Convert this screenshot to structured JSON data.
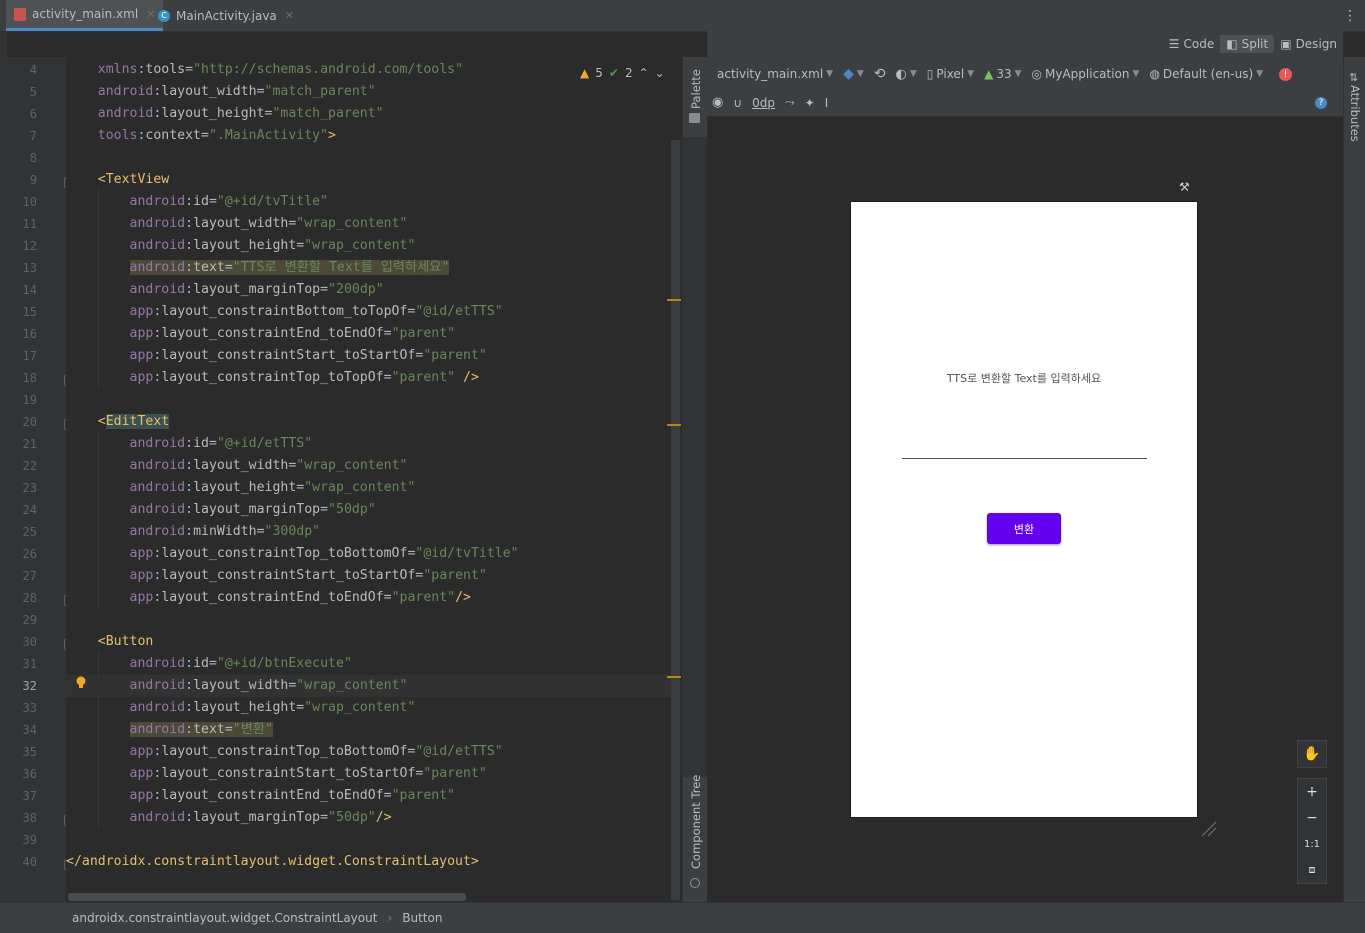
{
  "tabs": [
    {
      "label": "activity_main.xml",
      "active": true
    },
    {
      "label": "MainActivity.java",
      "active": false
    }
  ],
  "editor": {
    "warnings": "5",
    "weak_warnings": "2",
    "line_numbers": [
      "4",
      "5",
      "6",
      "7",
      "8",
      "9",
      "10",
      "11",
      "12",
      "13",
      "14",
      "15",
      "16",
      "17",
      "18",
      "19",
      "20",
      "21",
      "22",
      "23",
      "24",
      "25",
      "26",
      "27",
      "28",
      "29",
      "30",
      "31",
      "32",
      "33",
      "34",
      "35",
      "36",
      "37",
      "38",
      "39",
      "40"
    ],
    "current_line": "32",
    "lines": [
      {
        "indent": "    ",
        "parts": [
          [
            "an",
            "xmlns"
          ],
          [
            "pu",
            ":"
          ],
          [
            "at",
            "tools"
          ],
          [
            "pu",
            "="
          ],
          [
            "av",
            "\"http://schemas.android.com/tools\""
          ]
        ]
      },
      {
        "indent": "    ",
        "parts": [
          [
            "an",
            "android"
          ],
          [
            "pu",
            ":"
          ],
          [
            "at",
            "layout_width"
          ],
          [
            "pu",
            "="
          ],
          [
            "av",
            "\"match_parent\""
          ]
        ]
      },
      {
        "indent": "    ",
        "parts": [
          [
            "an",
            "android"
          ],
          [
            "pu",
            ":"
          ],
          [
            "at",
            "layout_height"
          ],
          [
            "pu",
            "="
          ],
          [
            "av",
            "\"match_parent\""
          ]
        ]
      },
      {
        "indent": "    ",
        "parts": [
          [
            "an",
            "tools"
          ],
          [
            "pu",
            ":"
          ],
          [
            "at",
            "context"
          ],
          [
            "pu",
            "="
          ],
          [
            "av",
            "\".MainActivity\""
          ],
          [
            "tg",
            ">"
          ]
        ]
      },
      {
        "indent": "",
        "parts": []
      },
      {
        "indent": "    ",
        "parts": [
          [
            "tg",
            "<TextView"
          ]
        ]
      },
      {
        "indent": "        ",
        "parts": [
          [
            "an",
            "android"
          ],
          [
            "pu",
            ":"
          ],
          [
            "at",
            "id"
          ],
          [
            "pu",
            "="
          ],
          [
            "av",
            "\"@+id/tvTitle\""
          ]
        ]
      },
      {
        "indent": "        ",
        "parts": [
          [
            "an",
            "android"
          ],
          [
            "pu",
            ":"
          ],
          [
            "at",
            "layout_width"
          ],
          [
            "pu",
            "="
          ],
          [
            "av",
            "\"wrap_content\""
          ]
        ]
      },
      {
        "indent": "        ",
        "parts": [
          [
            "an",
            "android"
          ],
          [
            "pu",
            ":"
          ],
          [
            "at",
            "layout_height"
          ],
          [
            "pu",
            "="
          ],
          [
            "av",
            "\"wrap_content\""
          ]
        ]
      },
      {
        "indent": "        ",
        "hl": true,
        "parts": [
          [
            "an",
            "android"
          ],
          [
            "pu",
            ":"
          ],
          [
            "at",
            "text"
          ],
          [
            "pu",
            "="
          ],
          [
            "av",
            "\"TTS로 변환할 Text를 입력하세요\""
          ]
        ]
      },
      {
        "indent": "        ",
        "parts": [
          [
            "an",
            "android"
          ],
          [
            "pu",
            ":"
          ],
          [
            "at",
            "layout_marginTop"
          ],
          [
            "pu",
            "="
          ],
          [
            "av",
            "\"200dp\""
          ]
        ]
      },
      {
        "indent": "        ",
        "parts": [
          [
            "an",
            "app"
          ],
          [
            "pu",
            ":"
          ],
          [
            "at",
            "layout_constraintBottom_toTopOf"
          ],
          [
            "pu",
            "="
          ],
          [
            "av",
            "\"@id/etTTS\""
          ]
        ]
      },
      {
        "indent": "        ",
        "parts": [
          [
            "an",
            "app"
          ],
          [
            "pu",
            ":"
          ],
          [
            "at",
            "layout_constraintEnd_toEndOf"
          ],
          [
            "pu",
            "="
          ],
          [
            "av",
            "\"parent\""
          ]
        ]
      },
      {
        "indent": "        ",
        "parts": [
          [
            "an",
            "app"
          ],
          [
            "pu",
            ":"
          ],
          [
            "at",
            "layout_constraintStart_toStartOf"
          ],
          [
            "pu",
            "="
          ],
          [
            "av",
            "\"parent\""
          ]
        ]
      },
      {
        "indent": "        ",
        "parts": [
          [
            "an",
            "app"
          ],
          [
            "pu",
            ":"
          ],
          [
            "at",
            "layout_constraintTop_toTopOf"
          ],
          [
            "pu",
            "="
          ],
          [
            "av",
            "\"parent\""
          ],
          [
            "tg",
            " />"
          ]
        ]
      },
      {
        "indent": "",
        "parts": []
      },
      {
        "indent": "    ",
        "parts": [
          [
            "tg",
            "<"
          ],
          [
            "hltag",
            "EditText"
          ]
        ]
      },
      {
        "indent": "        ",
        "parts": [
          [
            "an",
            "android"
          ],
          [
            "pu",
            ":"
          ],
          [
            "at",
            "id"
          ],
          [
            "pu",
            "="
          ],
          [
            "av",
            "\"@+id/etTTS\""
          ]
        ]
      },
      {
        "indent": "        ",
        "parts": [
          [
            "an",
            "android"
          ],
          [
            "pu",
            ":"
          ],
          [
            "at",
            "layout_width"
          ],
          [
            "pu",
            "="
          ],
          [
            "av",
            "\"wrap_content\""
          ]
        ]
      },
      {
        "indent": "        ",
        "parts": [
          [
            "an",
            "android"
          ],
          [
            "pu",
            ":"
          ],
          [
            "at",
            "layout_height"
          ],
          [
            "pu",
            "="
          ],
          [
            "av",
            "\"wrap_content\""
          ]
        ]
      },
      {
        "indent": "        ",
        "parts": [
          [
            "an",
            "android"
          ],
          [
            "pu",
            ":"
          ],
          [
            "at",
            "layout_marginTop"
          ],
          [
            "pu",
            "="
          ],
          [
            "av",
            "\"50dp\""
          ]
        ]
      },
      {
        "indent": "        ",
        "parts": [
          [
            "an",
            "android"
          ],
          [
            "pu",
            ":"
          ],
          [
            "at",
            "minWidth"
          ],
          [
            "pu",
            "="
          ],
          [
            "av",
            "\"300dp\""
          ]
        ]
      },
      {
        "indent": "        ",
        "parts": [
          [
            "an",
            "app"
          ],
          [
            "pu",
            ":"
          ],
          [
            "at",
            "layout_constraintTop_toBottomOf"
          ],
          [
            "pu",
            "="
          ],
          [
            "av",
            "\"@id/tvTitle\""
          ]
        ]
      },
      {
        "indent": "        ",
        "parts": [
          [
            "an",
            "app"
          ],
          [
            "pu",
            ":"
          ],
          [
            "at",
            "layout_constraintStart_toStartOf"
          ],
          [
            "pu",
            "="
          ],
          [
            "av",
            "\"parent\""
          ]
        ]
      },
      {
        "indent": "        ",
        "parts": [
          [
            "an",
            "app"
          ],
          [
            "pu",
            ":"
          ],
          [
            "at",
            "layout_constraintEnd_toEndOf"
          ],
          [
            "pu",
            "="
          ],
          [
            "av",
            "\"parent\""
          ],
          [
            "tg",
            "/>"
          ]
        ]
      },
      {
        "indent": "",
        "parts": []
      },
      {
        "indent": "    ",
        "parts": [
          [
            "tg",
            "<Button"
          ]
        ]
      },
      {
        "indent": "        ",
        "parts": [
          [
            "an",
            "android"
          ],
          [
            "pu",
            ":"
          ],
          [
            "at",
            "id"
          ],
          [
            "pu",
            "="
          ],
          [
            "av",
            "\"@+id/btnExecute\""
          ]
        ]
      },
      {
        "indent": "        ",
        "cur": true,
        "parts": [
          [
            "an",
            "android"
          ],
          [
            "pu",
            ":"
          ],
          [
            "at",
            "layout_width"
          ],
          [
            "pu",
            "="
          ],
          [
            "av",
            "\"wrap_content\""
          ]
        ]
      },
      {
        "indent": "        ",
        "parts": [
          [
            "an",
            "android"
          ],
          [
            "pu",
            ":"
          ],
          [
            "at",
            "layout_height"
          ],
          [
            "pu",
            "="
          ],
          [
            "av",
            "\"wrap_content\""
          ]
        ]
      },
      {
        "indent": "        ",
        "hl": true,
        "parts": [
          [
            "an",
            "android"
          ],
          [
            "pu",
            ":"
          ],
          [
            "at",
            "text"
          ],
          [
            "pu",
            "="
          ],
          [
            "av",
            "\"변환\""
          ]
        ]
      },
      {
        "indent": "        ",
        "parts": [
          [
            "an",
            "app"
          ],
          [
            "pu",
            ":"
          ],
          [
            "at",
            "layout_constraintTop_toBottomOf"
          ],
          [
            "pu",
            "="
          ],
          [
            "av",
            "\"@id/etTTS\""
          ]
        ]
      },
      {
        "indent": "        ",
        "parts": [
          [
            "an",
            "app"
          ],
          [
            "pu",
            ":"
          ],
          [
            "at",
            "layout_constraintStart_toStartOf"
          ],
          [
            "pu",
            "="
          ],
          [
            "av",
            "\"parent\""
          ]
        ]
      },
      {
        "indent": "        ",
        "parts": [
          [
            "an",
            "app"
          ],
          [
            "pu",
            ":"
          ],
          [
            "at",
            "layout_constraintEnd_toEndOf"
          ],
          [
            "pu",
            "="
          ],
          [
            "av",
            "\"parent\""
          ]
        ]
      },
      {
        "indent": "        ",
        "parts": [
          [
            "an",
            "android"
          ],
          [
            "pu",
            ":"
          ],
          [
            "at",
            "layout_marginTop"
          ],
          [
            "pu",
            "="
          ],
          [
            "av",
            "\"50dp\""
          ],
          [
            "tg",
            "/>"
          ]
        ]
      },
      {
        "indent": "",
        "parts": []
      },
      {
        "indent": "",
        "parts": [
          [
            "tg",
            "</androidx.constraintlayout.widget.ConstraintLayout>"
          ]
        ]
      }
    ]
  },
  "side_panels": {
    "palette": "Palette",
    "component_tree": "Component Tree",
    "attributes": "Attributes"
  },
  "view_modes": {
    "code": "Code",
    "split": "Split",
    "design": "Design"
  },
  "design_toolbar": {
    "file": "activity_main.xml",
    "device": "Pixel",
    "api": "33",
    "app": "MyApplication",
    "locale": "Default (en-us)",
    "margin": "0dp"
  },
  "preview": {
    "text_view": "TTS로 변환할 Text를 입력하세요",
    "button": "변환",
    "zoom_ratio": "1:1"
  },
  "breadcrumb": [
    "androidx.constraintlayout.widget.ConstraintLayout",
    "Button"
  ],
  "colors": {
    "button": "#6200ee",
    "keyword": "#e8bf6a",
    "string": "#6a8759",
    "namespace": "#9876aa"
  }
}
